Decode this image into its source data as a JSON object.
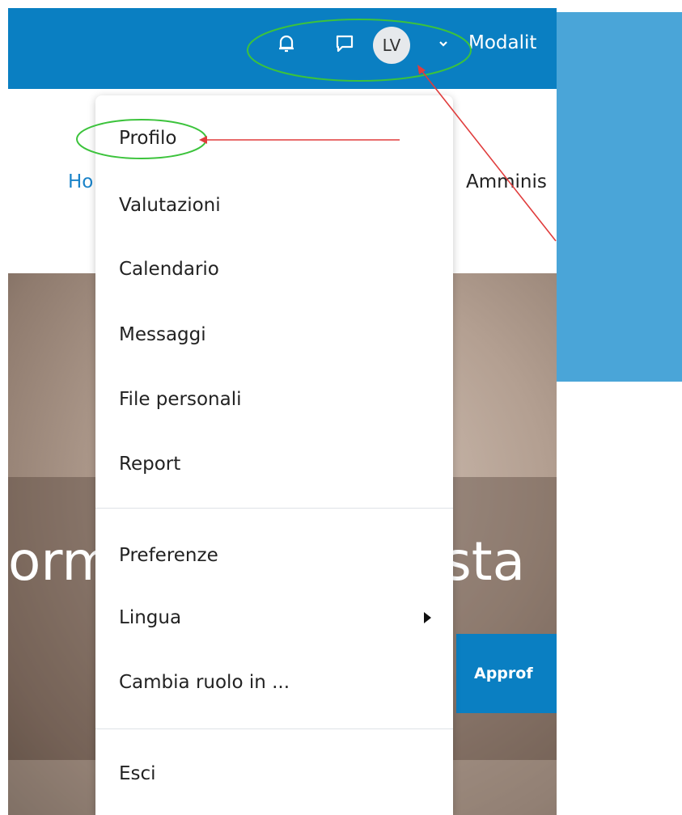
{
  "header": {
    "notifications_icon": "bell-icon",
    "messages_icon": "chat-icon",
    "avatar_initials": "LV",
    "user_menu_icon": "chevron-down-icon",
    "mode_label": "Modalit"
  },
  "nav": {
    "home_label": "Ho",
    "admin_label": "Amminis"
  },
  "hero": {
    "left_text": "orm",
    "right_text": "ista",
    "button_label": "Approf"
  },
  "user_menu": {
    "items": [
      {
        "label": "Profilo"
      },
      {
        "label": "Valutazioni"
      },
      {
        "label": "Calendario"
      },
      {
        "label": "Messaggi"
      },
      {
        "label": "File personali"
      },
      {
        "label": "Report"
      },
      {
        "label": "Preferenze"
      },
      {
        "label": "Lingua"
      },
      {
        "label": "Cambia ruolo in ..."
      },
      {
        "label": "Esci"
      }
    ],
    "submenu_icon": "triangle-right-icon"
  },
  "colors": {
    "topbar": "#0a7fc2",
    "side_panel": "#4aa5d8",
    "annotation_ellipse": "#3cc33c",
    "annotation_arrow": "#e03c3c"
  }
}
